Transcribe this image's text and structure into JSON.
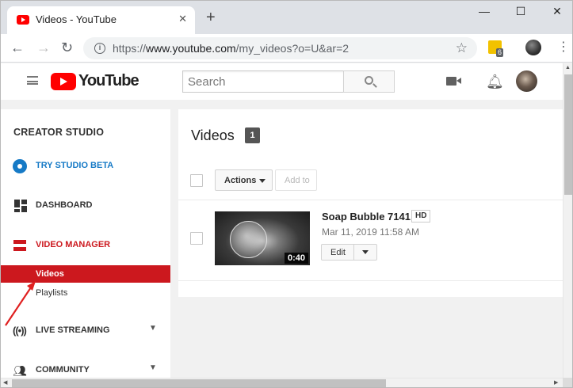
{
  "browser": {
    "tab_title": "Videos - YouTube",
    "tab_close": "✕",
    "new_tab": "+",
    "window_minimize": "—",
    "window_maximize": "☐",
    "window_close": "✕",
    "url_scheme": "https://",
    "url_host": "www.youtube.com",
    "url_path": "/my_videos?o=U&ar=2",
    "extension_badge": "6"
  },
  "header": {
    "logo_text": "YouTube",
    "search_placeholder": "Search"
  },
  "sidebar": {
    "heading": "CREATOR STUDIO",
    "items": [
      {
        "label": "TRY STUDIO BETA",
        "icon": "gear-icon",
        "color": "#167ac6"
      },
      {
        "label": "DASHBOARD",
        "icon": "dashboard-icon"
      },
      {
        "label": "VIDEO MANAGER",
        "icon": "video-manager-icon",
        "color": "#cc181e"
      },
      {
        "label": "LIVE STREAMING",
        "icon": "live-streaming-icon"
      },
      {
        "label": "COMMUNITY",
        "icon": "community-icon"
      }
    ],
    "sub_items": [
      {
        "label": "Videos",
        "active": true
      },
      {
        "label": "Playlists",
        "active": false
      }
    ]
  },
  "main": {
    "title": "Videos",
    "count": "1",
    "actions_label": "Actions",
    "add_to_label": "Add to",
    "videos": [
      {
        "title": "Soap Bubble 7141",
        "quality": "HD",
        "date": "Mar 11, 2019 11:58 AM",
        "duration": "0:40",
        "edit_label": "Edit"
      }
    ]
  },
  "colors": {
    "accent_red": "#cc181e",
    "link_blue": "#167ac6"
  }
}
